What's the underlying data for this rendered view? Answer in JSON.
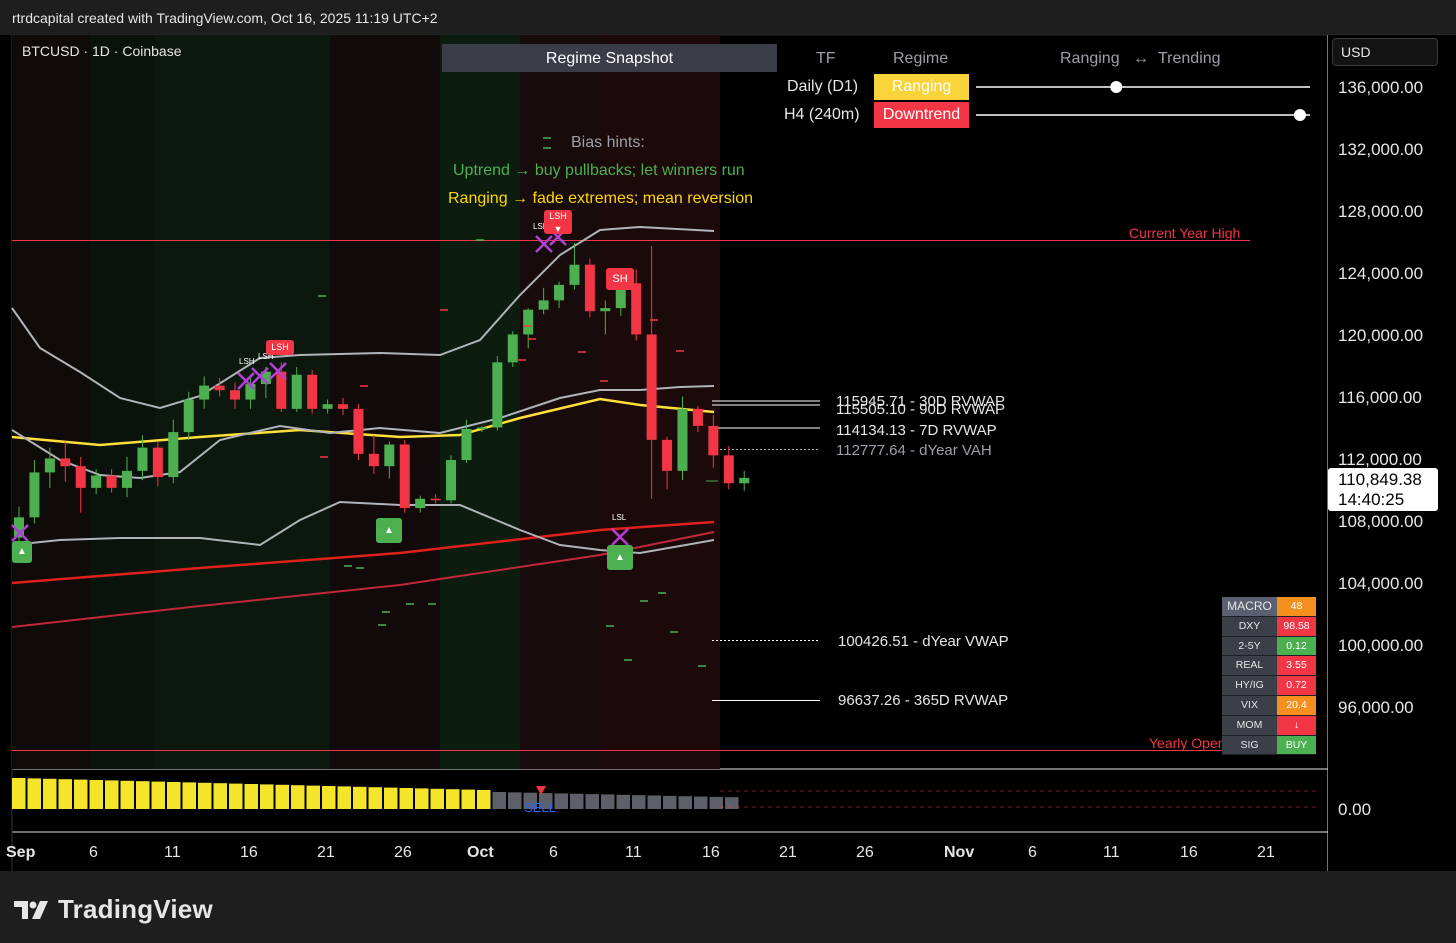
{
  "header": {
    "caption": "rtrdcapital created with TradingView.com, Oct 16, 2025 11:19 UTC+2"
  },
  "symbol_line": "BTCUSD · 1D · Coinbase",
  "currency_button": "USD",
  "price_axis": [
    "136,000.00",
    "132,000.00",
    "128,000.00",
    "124,000.00",
    "120,000.00",
    "116,000.00",
    "112,000.00",
    "108,000.00",
    "104,000.00",
    "100,000.00",
    "96,000.00"
  ],
  "last_price": {
    "value": "110,849.38",
    "countdown": "14:40:25"
  },
  "oscillator_axis": "0.00",
  "time_axis": [
    {
      "label": "Sep",
      "bold": true
    },
    {
      "label": "6",
      "bold": false
    },
    {
      "label": "11",
      "bold": false
    },
    {
      "label": "16",
      "bold": false
    },
    {
      "label": "21",
      "bold": false
    },
    {
      "label": "26",
      "bold": false
    },
    {
      "label": "Oct",
      "bold": true
    },
    {
      "label": "6",
      "bold": false
    },
    {
      "label": "11",
      "bold": false
    },
    {
      "label": "16",
      "bold": false
    },
    {
      "label": "21",
      "bold": false
    },
    {
      "label": "26",
      "bold": false
    },
    {
      "label": "Nov",
      "bold": true
    },
    {
      "label": "6",
      "bold": false
    },
    {
      "label": "11",
      "bold": false
    },
    {
      "label": "16",
      "bold": false
    },
    {
      "label": "21",
      "bold": false
    }
  ],
  "regime": {
    "title": "Regime Snapshot",
    "col_tf": "TF",
    "col_regime": "Regime",
    "col_scale_left": "Ranging",
    "col_scale_arrow": "↔",
    "col_scale_right": "Trending",
    "rows": [
      {
        "tf": "Daily (D1)",
        "regime": "Ranging",
        "bg": "#f8d33a",
        "fg": "#ffffff",
        "position": 0.42
      },
      {
        "tf": "H4 (240m)",
        "regime": "Downtrend",
        "bg": "#f23645",
        "fg": "#ffffff",
        "position": 0.97
      }
    ]
  },
  "bias": {
    "title": "Bias hints:",
    "line1": "Uptrend → buy pullbacks; let winners run",
    "line2": "Ranging → fade extremes; mean reversion",
    "color1": "#4caf50",
    "color2": "#ffd600"
  },
  "levels": [
    {
      "label": "115945.71 - 30D RVWAP"
    },
    {
      "label": "115505.10 - 90D RVWAP"
    },
    {
      "label": "114134.13 - 7D RVWAP"
    },
    {
      "label": "112777.64 - dYear VAH"
    },
    {
      "label": "100426.51 - dYear VWAP"
    },
    {
      "label": "96637.26 - 365D RVWAP"
    }
  ],
  "ref_lines": {
    "year_high": "Current Year High",
    "year_open": "Yearly Open"
  },
  "markers": {
    "lsh": "LSH",
    "sh": "SH",
    "lsl": "LSL",
    "up": "▲",
    "down": "▼",
    "sell": "SELL"
  },
  "macro": {
    "head_k": "MACRO",
    "head_v": "48",
    "head_color": "#f5901e",
    "rows": [
      {
        "k": "DXY",
        "v": "98.58",
        "color": "#f23645"
      },
      {
        "k": "2-5Y",
        "v": "0.12",
        "color": "#4caf50"
      },
      {
        "k": "REAL",
        "v": "3.55",
        "color": "#f23645"
      },
      {
        "k": "HY/IG",
        "v": "0.72",
        "color": "#f23645"
      },
      {
        "k": "VIX",
        "v": "20.4",
        "color": "#f5901e"
      },
      {
        "k": "MOM",
        "v": "↓",
        "color": "#f23645"
      },
      {
        "k": "SIG",
        "v": "BUY",
        "color": "#4caf50"
      }
    ]
  },
  "colors": {
    "up": "#4caf50",
    "down": "#f23645",
    "yellow": "#ffe03a",
    "red_ma": "#e0201b",
    "oscillator_yellow": "#f5e52a",
    "oscillator_grey": "#5d6068"
  },
  "brand": "TradingView",
  "chart_data": {
    "type": "candlestick",
    "ylim": [
      92000,
      138000
    ],
    "candles": [
      [
        107000,
        109000,
        106000,
        108300
      ],
      [
        108300,
        112000,
        107900,
        111200
      ],
      [
        111200,
        112800,
        110200,
        112100
      ],
      [
        112100,
        113200,
        110600,
        111600
      ],
      [
        111600,
        112200,
        108600,
        110200
      ],
      [
        110200,
        111400,
        109800,
        111000
      ],
      [
        111000,
        111400,
        109900,
        110200
      ],
      [
        110200,
        112200,
        109600,
        111300
      ],
      [
        111300,
        113600,
        110700,
        112800
      ],
      [
        112800,
        113200,
        110300,
        110900
      ],
      [
        110900,
        114600,
        110500,
        113800
      ],
      [
        113800,
        116400,
        113300,
        115900
      ],
      [
        115900,
        117400,
        115300,
        116800
      ],
      [
        116800,
        117300,
        116100,
        116500
      ],
      [
        116500,
        117000,
        115300,
        115900
      ],
      [
        115900,
        117500,
        115300,
        116900
      ],
      [
        116900,
        118000,
        116000,
        117700
      ],
      [
        117700,
        118300,
        115100,
        115300
      ],
      [
        115300,
        118000,
        115100,
        117500
      ],
      [
        117500,
        117800,
        115000,
        115300
      ],
      [
        115300,
        115900,
        115000,
        115600
      ],
      [
        115600,
        116000,
        114900,
        115300
      ],
      [
        115300,
        115600,
        112000,
        112400
      ],
      [
        112400,
        113600,
        111100,
        111600
      ],
      [
        111600,
        113200,
        110800,
        113000
      ],
      [
        113000,
        113300,
        108600,
        108900
      ],
      [
        108900,
        109700,
        108600,
        109500
      ],
      [
        109500,
        109800,
        109200,
        109400
      ],
      [
        109400,
        112300,
        109200,
        112000
      ],
      [
        112000,
        114600,
        111800,
        114000
      ],
      [
        114000,
        114200,
        113800,
        114100
      ],
      [
        114100,
        118700,
        113900,
        118300
      ],
      [
        118300,
        120300,
        118000,
        120100
      ],
      [
        120100,
        121800,
        119200,
        121700
      ],
      [
        121700,
        123100,
        121400,
        122300
      ],
      [
        122300,
        123500,
        121800,
        123300
      ],
      [
        123300,
        126000,
        123000,
        124600
      ],
      [
        124600,
        125000,
        121200,
        121600
      ],
      [
        121600,
        122300,
        120100,
        121800
      ],
      [
        121800,
        123600,
        121300,
        123400
      ],
      [
        123400,
        124300,
        119700,
        120100
      ],
      [
        120100,
        125800,
        109500,
        113300
      ],
      [
        113300,
        113500,
        110100,
        111300
      ],
      [
        111300,
        116100,
        110700,
        115300
      ],
      [
        115300,
        115500,
        113800,
        114200
      ],
      [
        114200,
        114900,
        111500,
        112300
      ],
      [
        112300,
        112900,
        110100,
        110500
      ],
      [
        110500,
        111300,
        110000,
        110849
      ]
    ]
  }
}
